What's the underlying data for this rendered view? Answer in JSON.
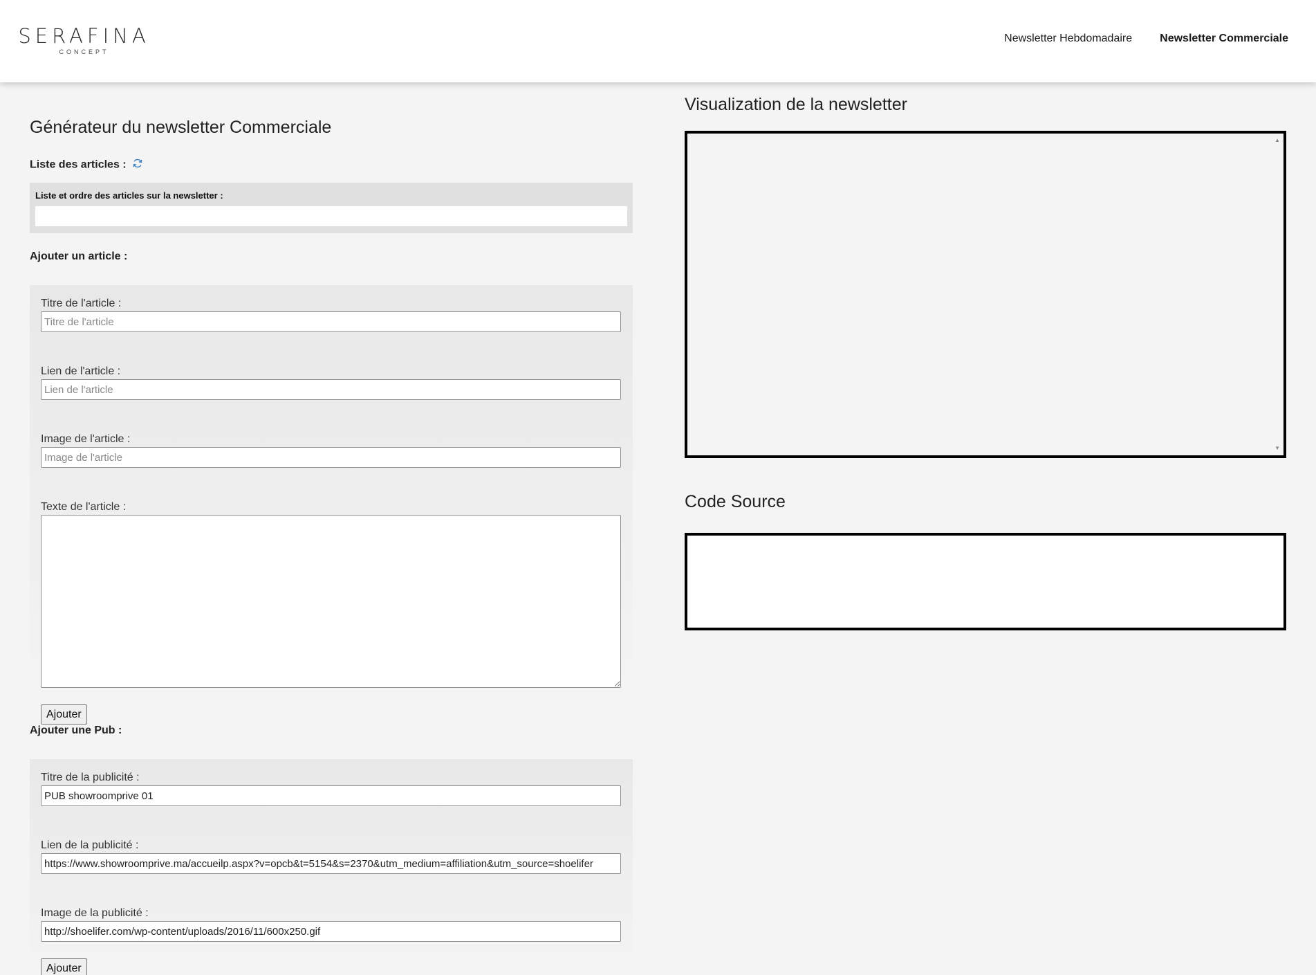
{
  "header": {
    "logo_main": "SERAFINA",
    "logo_sub": "CONCEPT",
    "nav": [
      {
        "label": "Newsletter Hebdomadaire"
      },
      {
        "label": "Newsletter Commerciale"
      }
    ]
  },
  "generator": {
    "title": "Générateur du newsletter Commerciale",
    "articles_list_label": "Liste des articles :",
    "order_label": "Liste et ordre des articles sur la newsletter :"
  },
  "article_form": {
    "section_label": "Ajouter un article :",
    "title_label": "Titre de l'article :",
    "title_placeholder": "Titre de l'article",
    "link_label": "Lien de l'article :",
    "link_placeholder": "Lien de l'article",
    "image_label": "Image de l'article :",
    "image_placeholder": "Image de l'article",
    "text_label": "Texte de l'article :",
    "submit_label": "Ajouter"
  },
  "pub_form": {
    "section_label": "Ajouter une Pub :",
    "title_label": "Titre de la publicité :",
    "title_value": "PUB showroomprive 01",
    "link_label": "Lien de la publicité :",
    "link_value": "https://www.showroomprive.ma/accueilp.aspx?v=opcb&t=5154&s=2370&utm_medium=affiliation&utm_source=shoelifer",
    "image_label": "Image de la publicité :",
    "image_value": "http://shoelifer.com/wp-content/uploads/2016/11/600x250.gif",
    "submit_label": "Ajouter"
  },
  "preview": {
    "title": "Visualization de la newsletter"
  },
  "source": {
    "title": "Code Source"
  },
  "colors": {
    "background": "#f4f4f4",
    "header": "#ffffff",
    "refresh_icon": "#3a7fc1"
  }
}
